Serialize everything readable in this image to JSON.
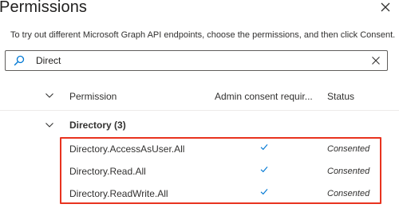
{
  "panel": {
    "title": "Permissions",
    "description": "To try out different Microsoft Graph API endpoints, choose the permissions, and then click Consent."
  },
  "search": {
    "value": "Direct"
  },
  "table": {
    "headers": {
      "permission": "Permission",
      "admin_consent": "Admin consent requir...",
      "status": "Status"
    },
    "group": {
      "label": "Directory (3)"
    },
    "rows": [
      {
        "name": "Directory.AccessAsUser.All",
        "admin_consent": "check-icon",
        "status": "Consented"
      },
      {
        "name": "Directory.Read.All",
        "admin_consent": "check-icon",
        "status": "Consented"
      },
      {
        "name": "Directory.ReadWrite.All",
        "admin_consent": "check-icon",
        "status": "Consented"
      }
    ]
  },
  "colors": {
    "highlight_border": "#e8331f",
    "check_color": "#0078d4",
    "text": "#323130"
  }
}
